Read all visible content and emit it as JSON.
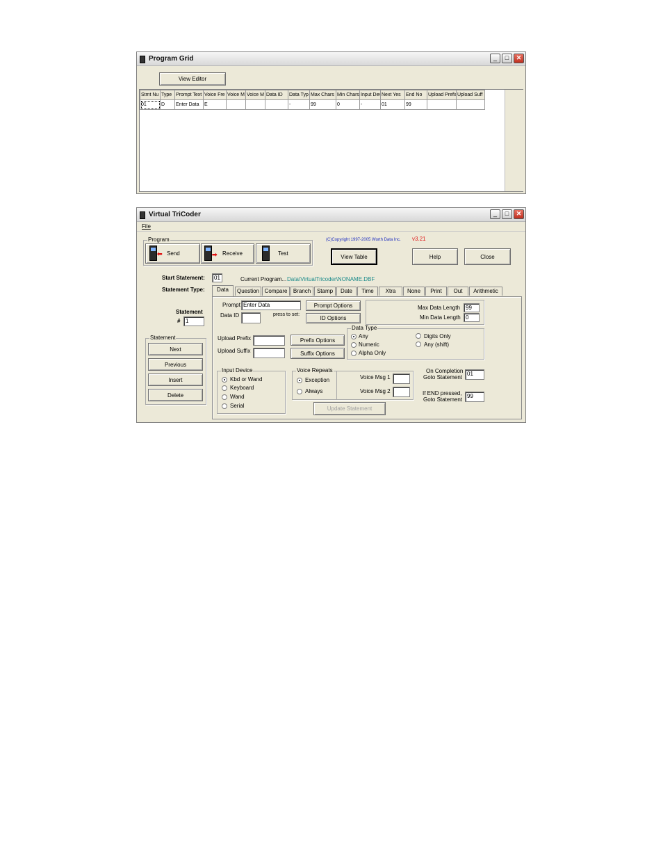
{
  "program_grid": {
    "title": "Program Grid",
    "view_editor_label": "View Editor",
    "columns": [
      "Stmt Nu",
      "Type",
      "Prompt Text",
      "Voice Fre",
      "Voice M",
      "Voice M",
      "Data ID",
      "Data Typ",
      "Max Chars",
      "Min Chars",
      "Input Dev",
      "Next Yes",
      "End No",
      "Upload Prefix",
      "Upload Suff"
    ],
    "rows": [
      [
        "01",
        "D",
        "Enter Data",
        "E",
        "",
        "",
        "",
        "-",
        "99",
        "0",
        "-",
        "01",
        "99",
        "",
        ""
      ]
    ]
  },
  "tricoder": {
    "title": "Virtual TriCoder",
    "menu_file": "File",
    "program_group": "Program",
    "send_label": "Send",
    "receive_label": "Receive",
    "test_label": "Test",
    "copyright": "(C)Copyright 1997-2005 Worth Data Inc.",
    "version": "v3.21",
    "view_table_label": "View Table",
    "help_label": "Help",
    "close_label": "Close",
    "start_statement_label": "Start Statement:",
    "start_statement_value": "01",
    "current_program_label": "Current Program...",
    "current_program_value": "Data\\VirtualTricoder\\NONAME.DBF",
    "statement_type_label": "Statement Type:",
    "tabs": [
      "Data",
      "Question",
      "Compare",
      "Branch",
      "Stamp",
      "Date",
      "Time",
      "Xtra",
      "None",
      "Print",
      "Out",
      "Arithmetic"
    ],
    "statement_label": "Statement",
    "statement_hash": "#",
    "statement_value": "1",
    "statement_group": "Statement",
    "next_label": "Next",
    "previous_label": "Previous",
    "insert_label": "Insert",
    "delete_label": "Delete",
    "prompt_label": "Prompt",
    "prompt_value": "Enter Data",
    "prompt_options_label": "Prompt Options",
    "data_id_label": "Data ID",
    "data_id_value": "",
    "press_to_set": "press to set:",
    "id_options_label": "ID Options",
    "max_data_length_label": "Max Data Length",
    "max_data_length_value": "99",
    "min_data_length_label": "Min Data Length",
    "min_data_length_value": "0",
    "data_type_group": "Data Type",
    "data_type_options": [
      "Any",
      "Numeric",
      "Alpha Only",
      "Digits Only",
      "Any (shift)"
    ],
    "data_type_selected": "Any",
    "upload_prefix_label": "Upload Prefix",
    "upload_suffix_label": "Upload Suffix",
    "prefix_options_label": "Prefix Options",
    "suffix_options_label": "Suffix Options",
    "input_device_group": "Input Device",
    "input_device_options": [
      "Kbd or Wand",
      "Keyboard",
      "Wand",
      "Serial"
    ],
    "input_device_selected": "Kbd or Wand",
    "voice_repeats_group": "Voice Repeats",
    "voice_repeats_options": [
      "Exception",
      "Always"
    ],
    "voice_repeats_selected": "Exception",
    "voice_msg1_label": "Voice Msg 1",
    "voice_msg2_label": "Voice Msg 2",
    "on_completion_label_1": "On Completion",
    "on_completion_label_2": "Goto Statement",
    "on_completion_value": "01",
    "if_end_label_1": "If END pressed,",
    "if_end_label_2": "Goto Statement",
    "if_end_value": "99",
    "update_statement_label": "Update Statement",
    "colors": {
      "version": "#e02020",
      "path": "#1a8a8a",
      "copyright": "#2030c0"
    }
  }
}
